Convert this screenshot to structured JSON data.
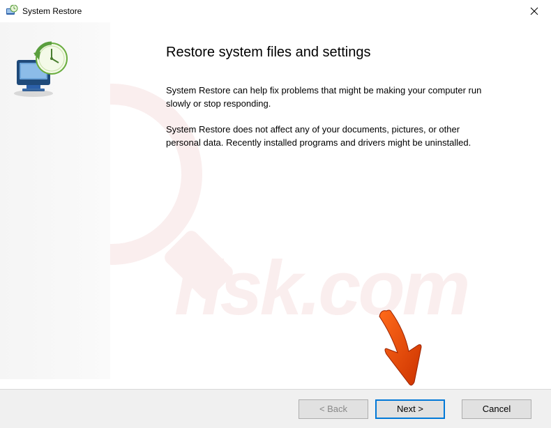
{
  "titlebar": {
    "title": "System Restore"
  },
  "main": {
    "heading": "Restore system files and settings",
    "para1": "System Restore can help fix problems that might be making your computer run slowly or stop responding.",
    "para2": "System Restore does not affect any of your documents, pictures, or other personal data. Recently installed programs and drivers might be uninstalled."
  },
  "footer": {
    "back": "< Back",
    "next": "Next >",
    "cancel": "Cancel"
  }
}
